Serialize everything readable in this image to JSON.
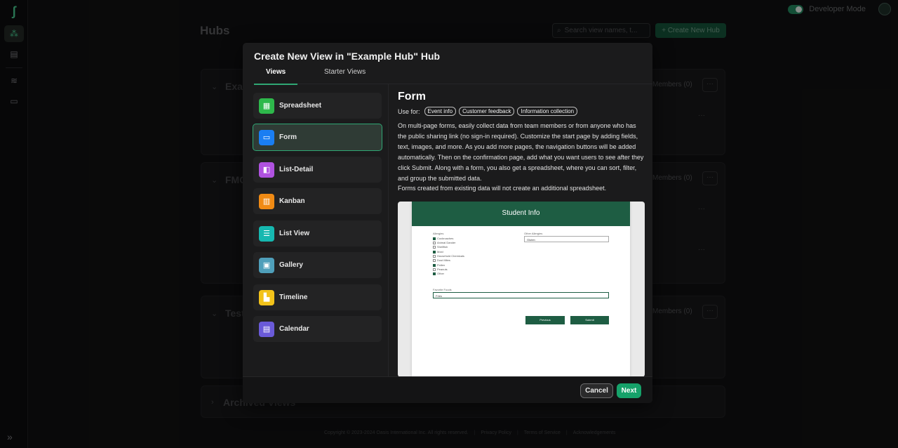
{
  "app": {
    "developer_mode_label": "Developer Mode",
    "hubs_title": "Hubs",
    "search_placeholder": "Search view names, t...",
    "create_hub_label": "+ Create New Hub"
  },
  "hubs": [
    {
      "title": "Exa",
      "members": "Members (0)"
    },
    {
      "title": "FMC",
      "members": "Members (0)"
    },
    {
      "title": "Test",
      "members": "Members (0)"
    },
    {
      "title": "Archived Views",
      "members": ""
    }
  ],
  "footer": {
    "copyright": "Copyright © 2023-2024 Oasis International Inc. All rights reserved.",
    "privacy": "Privacy Policy",
    "terms": "Terms of Service",
    "ack": "Acknowledgements"
  },
  "modal": {
    "title": "Create New View in \"Example Hub\" Hub",
    "tabs": [
      "Views",
      "Starter Views"
    ],
    "views": [
      {
        "label": "Spreadsheet",
        "icon": "spreadsheet-icon",
        "color": "#2eb84b"
      },
      {
        "label": "Form",
        "icon": "form-icon",
        "color": "#1a7ef2"
      },
      {
        "label": "List-Detail",
        "icon": "list-detail-icon",
        "color": "#b052e0"
      },
      {
        "label": "Kanban",
        "icon": "kanban-icon",
        "color": "#f08a14"
      },
      {
        "label": "List View",
        "icon": "list-view-icon",
        "color": "#16b8b0"
      },
      {
        "label": "Gallery",
        "icon": "gallery-icon",
        "color": "#4f9fba"
      },
      {
        "label": "Timeline",
        "icon": "timeline-icon",
        "color": "#f2c21a"
      },
      {
        "label": "Calendar",
        "icon": "calendar-icon",
        "color": "#6a5ad8"
      }
    ],
    "detail": {
      "title": "Form",
      "use_for_label": "Use for:",
      "chips": [
        "Event info",
        "Customer feedback",
        "Information collection"
      ],
      "description": "On multi-page forms, easily collect data from team members or from anyone who has the public sharing link (no sign-in required). Customize the start page by adding fields, text, images, and more. As you add more pages, the navigation buttons will be added automatically. Then on the confirmation page, add what you want users to see after they click Submit. Along with a form, you also get a spreadsheet, where you can sort, filter, and group the submitted data.",
      "note": "Forms created from existing data will not create an additional spreadsheet."
    },
    "preview": {
      "header": "Student Info",
      "allergies_label": "Allergies",
      "allergies": [
        {
          "label": "Cockroaches",
          "checked": true
        },
        {
          "label": "Animal Dander",
          "checked": false
        },
        {
          "label": "Shellfish",
          "checked": false
        },
        {
          "label": "Mold",
          "checked": true
        },
        {
          "label": "Household Chemicals",
          "checked": false
        },
        {
          "label": "Dust Mites",
          "checked": false
        },
        {
          "label": "Pollen",
          "checked": true
        },
        {
          "label": "Peanuts",
          "checked": false
        },
        {
          "label": "Other",
          "checked": true
        }
      ],
      "other_label": "Other Allergies",
      "other_value": "Gluten",
      "foods_label": "Favorite Foods",
      "foods_value": "Fries",
      "previous": "Previous",
      "submit": "Submit"
    },
    "cancel": "Cancel",
    "next": "Next"
  }
}
